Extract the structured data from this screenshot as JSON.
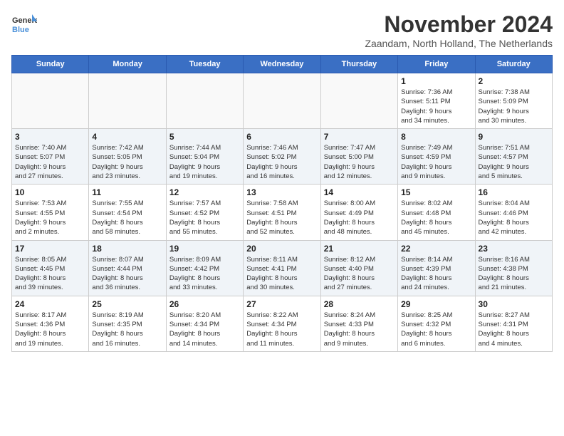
{
  "logo": {
    "text_general": "General",
    "text_blue": "Blue"
  },
  "title": "November 2024",
  "location": "Zaandam, North Holland, The Netherlands",
  "weekdays": [
    "Sunday",
    "Monday",
    "Tuesday",
    "Wednesday",
    "Thursday",
    "Friday",
    "Saturday"
  ],
  "weeks": [
    {
      "shaded": false,
      "days": [
        {
          "num": "",
          "info": ""
        },
        {
          "num": "",
          "info": ""
        },
        {
          "num": "",
          "info": ""
        },
        {
          "num": "",
          "info": ""
        },
        {
          "num": "",
          "info": ""
        },
        {
          "num": "1",
          "info": "Sunrise: 7:36 AM\nSunset: 5:11 PM\nDaylight: 9 hours\nand 34 minutes."
        },
        {
          "num": "2",
          "info": "Sunrise: 7:38 AM\nSunset: 5:09 PM\nDaylight: 9 hours\nand 30 minutes."
        }
      ]
    },
    {
      "shaded": true,
      "days": [
        {
          "num": "3",
          "info": "Sunrise: 7:40 AM\nSunset: 5:07 PM\nDaylight: 9 hours\nand 27 minutes."
        },
        {
          "num": "4",
          "info": "Sunrise: 7:42 AM\nSunset: 5:05 PM\nDaylight: 9 hours\nand 23 minutes."
        },
        {
          "num": "5",
          "info": "Sunrise: 7:44 AM\nSunset: 5:04 PM\nDaylight: 9 hours\nand 19 minutes."
        },
        {
          "num": "6",
          "info": "Sunrise: 7:46 AM\nSunset: 5:02 PM\nDaylight: 9 hours\nand 16 minutes."
        },
        {
          "num": "7",
          "info": "Sunrise: 7:47 AM\nSunset: 5:00 PM\nDaylight: 9 hours\nand 12 minutes."
        },
        {
          "num": "8",
          "info": "Sunrise: 7:49 AM\nSunset: 4:59 PM\nDaylight: 9 hours\nand 9 minutes."
        },
        {
          "num": "9",
          "info": "Sunrise: 7:51 AM\nSunset: 4:57 PM\nDaylight: 9 hours\nand 5 minutes."
        }
      ]
    },
    {
      "shaded": false,
      "days": [
        {
          "num": "10",
          "info": "Sunrise: 7:53 AM\nSunset: 4:55 PM\nDaylight: 9 hours\nand 2 minutes."
        },
        {
          "num": "11",
          "info": "Sunrise: 7:55 AM\nSunset: 4:54 PM\nDaylight: 8 hours\nand 58 minutes."
        },
        {
          "num": "12",
          "info": "Sunrise: 7:57 AM\nSunset: 4:52 PM\nDaylight: 8 hours\nand 55 minutes."
        },
        {
          "num": "13",
          "info": "Sunrise: 7:58 AM\nSunset: 4:51 PM\nDaylight: 8 hours\nand 52 minutes."
        },
        {
          "num": "14",
          "info": "Sunrise: 8:00 AM\nSunset: 4:49 PM\nDaylight: 8 hours\nand 48 minutes."
        },
        {
          "num": "15",
          "info": "Sunrise: 8:02 AM\nSunset: 4:48 PM\nDaylight: 8 hours\nand 45 minutes."
        },
        {
          "num": "16",
          "info": "Sunrise: 8:04 AM\nSunset: 4:46 PM\nDaylight: 8 hours\nand 42 minutes."
        }
      ]
    },
    {
      "shaded": true,
      "days": [
        {
          "num": "17",
          "info": "Sunrise: 8:05 AM\nSunset: 4:45 PM\nDaylight: 8 hours\nand 39 minutes."
        },
        {
          "num": "18",
          "info": "Sunrise: 8:07 AM\nSunset: 4:44 PM\nDaylight: 8 hours\nand 36 minutes."
        },
        {
          "num": "19",
          "info": "Sunrise: 8:09 AM\nSunset: 4:42 PM\nDaylight: 8 hours\nand 33 minutes."
        },
        {
          "num": "20",
          "info": "Sunrise: 8:11 AM\nSunset: 4:41 PM\nDaylight: 8 hours\nand 30 minutes."
        },
        {
          "num": "21",
          "info": "Sunrise: 8:12 AM\nSunset: 4:40 PM\nDaylight: 8 hours\nand 27 minutes."
        },
        {
          "num": "22",
          "info": "Sunrise: 8:14 AM\nSunset: 4:39 PM\nDaylight: 8 hours\nand 24 minutes."
        },
        {
          "num": "23",
          "info": "Sunrise: 8:16 AM\nSunset: 4:38 PM\nDaylight: 8 hours\nand 21 minutes."
        }
      ]
    },
    {
      "shaded": false,
      "days": [
        {
          "num": "24",
          "info": "Sunrise: 8:17 AM\nSunset: 4:36 PM\nDaylight: 8 hours\nand 19 minutes."
        },
        {
          "num": "25",
          "info": "Sunrise: 8:19 AM\nSunset: 4:35 PM\nDaylight: 8 hours\nand 16 minutes."
        },
        {
          "num": "26",
          "info": "Sunrise: 8:20 AM\nSunset: 4:34 PM\nDaylight: 8 hours\nand 14 minutes."
        },
        {
          "num": "27",
          "info": "Sunrise: 8:22 AM\nSunset: 4:34 PM\nDaylight: 8 hours\nand 11 minutes."
        },
        {
          "num": "28",
          "info": "Sunrise: 8:24 AM\nSunset: 4:33 PM\nDaylight: 8 hours\nand 9 minutes."
        },
        {
          "num": "29",
          "info": "Sunrise: 8:25 AM\nSunset: 4:32 PM\nDaylight: 8 hours\nand 6 minutes."
        },
        {
          "num": "30",
          "info": "Sunrise: 8:27 AM\nSunset: 4:31 PM\nDaylight: 8 hours\nand 4 minutes."
        }
      ]
    }
  ]
}
